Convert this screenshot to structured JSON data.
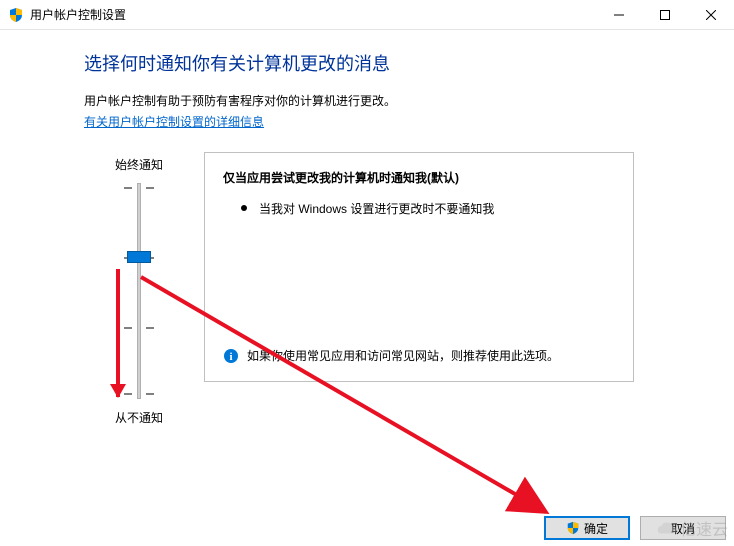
{
  "titlebar": {
    "title": "用户帐户控制设置"
  },
  "content": {
    "heading": "选择何时通知你有关计算机更改的消息",
    "description": "用户帐户控制有助于预防有害程序对你的计算机进行更改。",
    "link": "有关用户帐户控制设置的详细信息"
  },
  "slider": {
    "top_label": "始终通知",
    "bottom_label": "从不通知"
  },
  "panel": {
    "title": "仅当应用尝试更改我的计算机时通知我(默认)",
    "bullet": "当我对 Windows 设置进行更改时不要通知我",
    "info": "如果你使用常见应用和访问常见网站，则推荐使用此选项。"
  },
  "buttons": {
    "ok": "确定",
    "cancel": "取消"
  },
  "watermark": "亿速云"
}
